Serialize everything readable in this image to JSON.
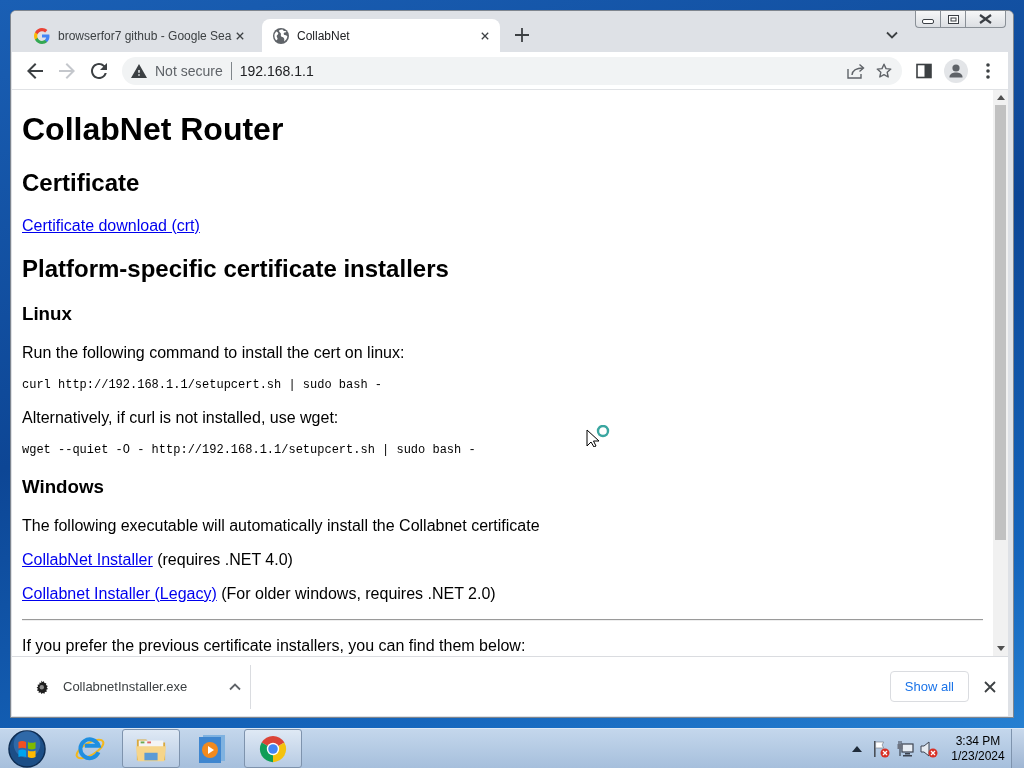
{
  "tabs": [
    {
      "kind": "search",
      "title": "browserfor7 github - Google Sea",
      "selected": false
    },
    {
      "kind": "page",
      "title": "CollabNet",
      "selected": true
    }
  ],
  "toolbar": {
    "back": {
      "disabled": false
    },
    "forward": {
      "disabled": true
    },
    "security_label": "Not secure",
    "url": "192.168.1.1"
  },
  "page": {
    "title": "CollabNet Router",
    "blocks": [
      {
        "kind": "h2",
        "text": "Certificate"
      },
      {
        "kind": "link",
        "text": "Certificate download (crt)"
      },
      {
        "kind": "h2",
        "text": "Platform-specific certificate installers"
      },
      {
        "kind": "h3",
        "text": "Linux"
      },
      {
        "kind": "p",
        "text": "Run the following command to install the cert on linux:"
      },
      {
        "kind": "code",
        "text": "curl http://192.168.1.1/setupcert.sh | sudo bash -"
      },
      {
        "kind": "p",
        "text": "Alternatively, if curl is not installed, use wget:"
      },
      {
        "kind": "code",
        "text": "wget --quiet -O - http://192.168.1.1/setupcert.sh | sudo bash -"
      },
      {
        "kind": "h3",
        "text": "Windows"
      },
      {
        "kind": "p",
        "text": "The following executable will automatically install the Collabnet certificate"
      },
      {
        "kind": "link_note",
        "link": "CollabNet Installer",
        "note": "(requires .NET 4.0)"
      },
      {
        "kind": "link_note",
        "link": "Collabnet Installer (Legacy)",
        "note": "(For older windows, requires .NET 2.0)"
      },
      {
        "kind": "hr"
      },
      {
        "kind": "p",
        "text": "If you prefer the previous certificate installers, you can find them below:"
      }
    ]
  },
  "downloads": {
    "items": [
      {
        "filename": "CollabnetInstaller.exe"
      }
    ],
    "show_all": "Show all"
  },
  "taskbar": {
    "apps": [
      {
        "kind": "ie",
        "open": false
      },
      {
        "kind": "folder",
        "open": true
      },
      {
        "kind": "media",
        "open": false
      },
      {
        "kind": "chrome",
        "open": true
      }
    ],
    "clock": {
      "time": "3:34 PM",
      "date": "1/23/2024"
    }
  }
}
